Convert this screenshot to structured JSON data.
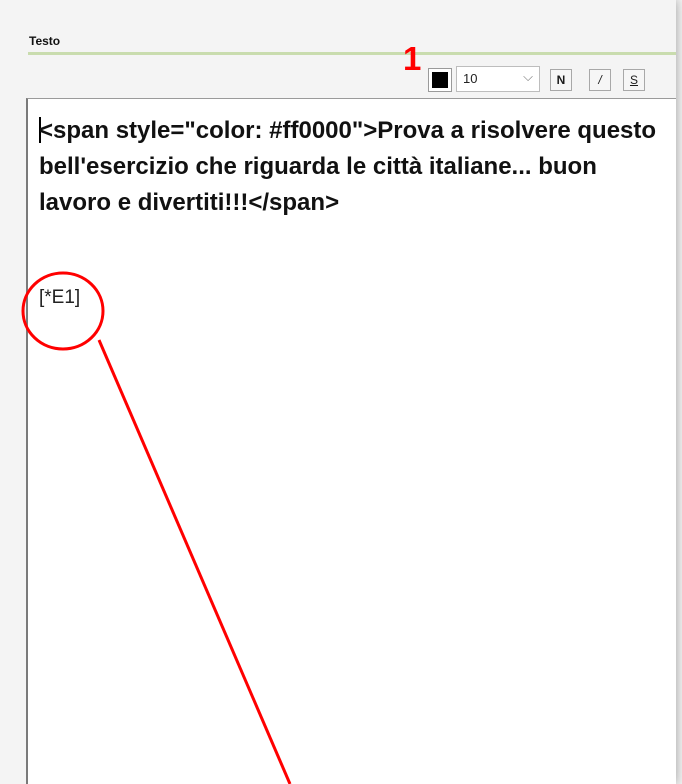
{
  "section": {
    "title": "Testo"
  },
  "toolbar": {
    "callout_number": "1",
    "text_color": "#000000",
    "font_size": "10",
    "bold_label": "N",
    "italic_label": "/",
    "strike_label": "S"
  },
  "editor": {
    "content": "<span style=\"color: #ff0000\">Prova a risolvere questo bell'esercizio che riguarda le città italiane... buon lavoro e divertiti!!!</span>",
    "placeholder_tag": "[*E1]"
  },
  "colors": {
    "accent_rule": "#c9dcae",
    "annotation": "#ff0000"
  },
  "icons": {
    "dropdown": "chevron-down-icon",
    "color": "color-swatch-icon"
  }
}
